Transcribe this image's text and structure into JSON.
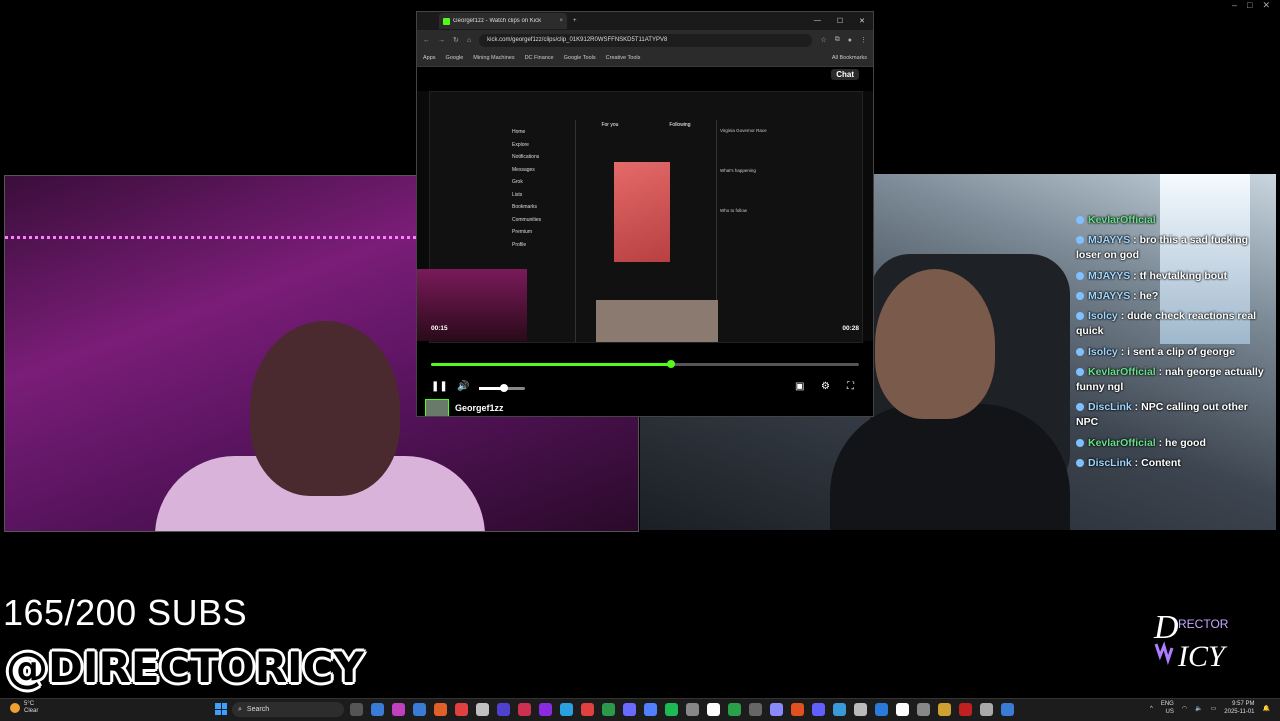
{
  "outer_window": {
    "min": "–",
    "max": "□",
    "close": "✕"
  },
  "browser": {
    "tab_title": "Georgef1zz - Watch clips on Kick",
    "tab_close": "×",
    "new_tab": "+",
    "win_min": "—",
    "win_max": "☐",
    "win_close": "✕",
    "url": "kick.com/georgef1zz/clips/clip_01K912R0WSFFNSKD5T11ATYPV8",
    "bookmarks": [
      "Apps",
      "Google",
      "Mining Machines",
      "DC Finance",
      "Google Tools",
      "Creative Tools"
    ],
    "all_bookmarks": "All Bookmarks"
  },
  "page": {
    "chat_label": "Chat",
    "x_sidebar": [
      "Home",
      "Explore",
      "Notifications",
      "Messages",
      "Grok",
      "Lists",
      "Bookmarks",
      "Communities",
      "Premium",
      "Profile"
    ],
    "x_right": [
      "Virginia Governor Race",
      "What's happening",
      "Who to follow"
    ],
    "x_feed_tabs": [
      "For you",
      "Following"
    ]
  },
  "player": {
    "time_current": "00:15",
    "time_total": "00:28",
    "progress": 0.56,
    "volume": 0.55,
    "channel_name": "Georgef1zz"
  },
  "chat": [
    {
      "name": "KevlarOfficial",
      "msg": "",
      "green": true
    },
    {
      "name": "MJAYYS",
      "msg": "bro this a sad fucking loser on god",
      "green": false
    },
    {
      "name": "MJAYYS",
      "msg": "tf hevtalking bout",
      "green": false
    },
    {
      "name": "MJAYYS",
      "msg": "he?",
      "green": false
    },
    {
      "name": "Isolcy",
      "msg": "dude check reactions real quick",
      "green": false
    },
    {
      "name": "Isolcy",
      "msg": "i sent a clip of george",
      "green": false
    },
    {
      "name": "KevlarOfficial",
      "msg": "nah george actually funny ngl",
      "green": true
    },
    {
      "name": "DiscLink",
      "msg": "NPC calling out other NPC",
      "green": false
    },
    {
      "name": "KevlarOfficial",
      "msg": "he good",
      "green": true
    },
    {
      "name": "DiscLink",
      "msg": "Content",
      "green": false
    }
  ],
  "overlay": {
    "subs": "165/200 SUBS",
    "handle": "@DIRECTORICY",
    "logo_text": "DIRECTOR ICY"
  },
  "taskbar": {
    "weather_temp": "5°C",
    "weather_cond": "Clear",
    "search": "Search",
    "lang": "ENG",
    "region": "US",
    "time": "9:57 PM",
    "date": "2025-11-01"
  },
  "colors": {
    "kick_green": "#53fc18",
    "chat_name": "#9fd6ff"
  }
}
